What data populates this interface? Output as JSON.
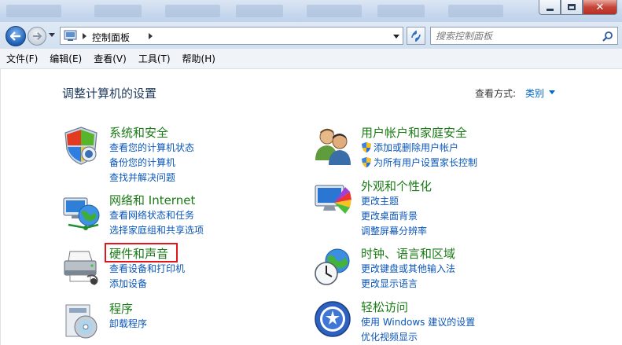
{
  "window": {
    "title_hidden": "",
    "buttons": [
      "minimize",
      "maximize",
      "close"
    ]
  },
  "nav": {
    "breadcrumb": "控制面板",
    "search_placeholder": "搜索控制面板"
  },
  "menu": [
    "文件(F)",
    "编辑(E)",
    "查看(V)",
    "工具(T)",
    "帮助(H)"
  ],
  "page": {
    "title": "调整计算机的设置",
    "view_by_label": "查看方式:",
    "view_by_value": "类别"
  },
  "categories_left": [
    {
      "title": "系统和安全",
      "icon": "shield-flag-icon",
      "links": [
        "查看您的计算机状态",
        "备份您的计算机",
        "查找并解决问题"
      ]
    },
    {
      "title": "网络和 Internet",
      "icon": "network-globe-icon",
      "links": [
        "查看网络状态和任务",
        "选择家庭组和共享选项"
      ]
    },
    {
      "title": "硬件和声音",
      "icon": "printer-icon",
      "highlighted": true,
      "links": [
        "查看设备和打印机",
        "添加设备"
      ]
    },
    {
      "title": "程序",
      "icon": "programs-disc-icon",
      "links": [
        "卸载程序"
      ]
    }
  ],
  "categories_right": [
    {
      "title": "用户帐户和家庭安全",
      "icon": "users-icon",
      "links": [
        "添加或删除用户帐户",
        "为所有用户设置家长控制"
      ],
      "shield_links": true
    },
    {
      "title": "外观和个性化",
      "icon": "monitor-palette-icon",
      "links": [
        "更改主题",
        "更改桌面背景",
        "调整屏幕分辨率"
      ]
    },
    {
      "title": "时钟、语言和区域",
      "icon": "clock-globe-icon",
      "links": [
        "更改键盘或其他输入法",
        "更改显示语言"
      ]
    },
    {
      "title": "轻松访问",
      "icon": "ease-of-access-icon",
      "links": [
        "使用 Windows 建议的设置",
        "优化视频显示"
      ]
    }
  ],
  "colors": {
    "category_title": "#1b7b16",
    "link": "#0b56b9",
    "highlight_box": "#e0161c"
  }
}
